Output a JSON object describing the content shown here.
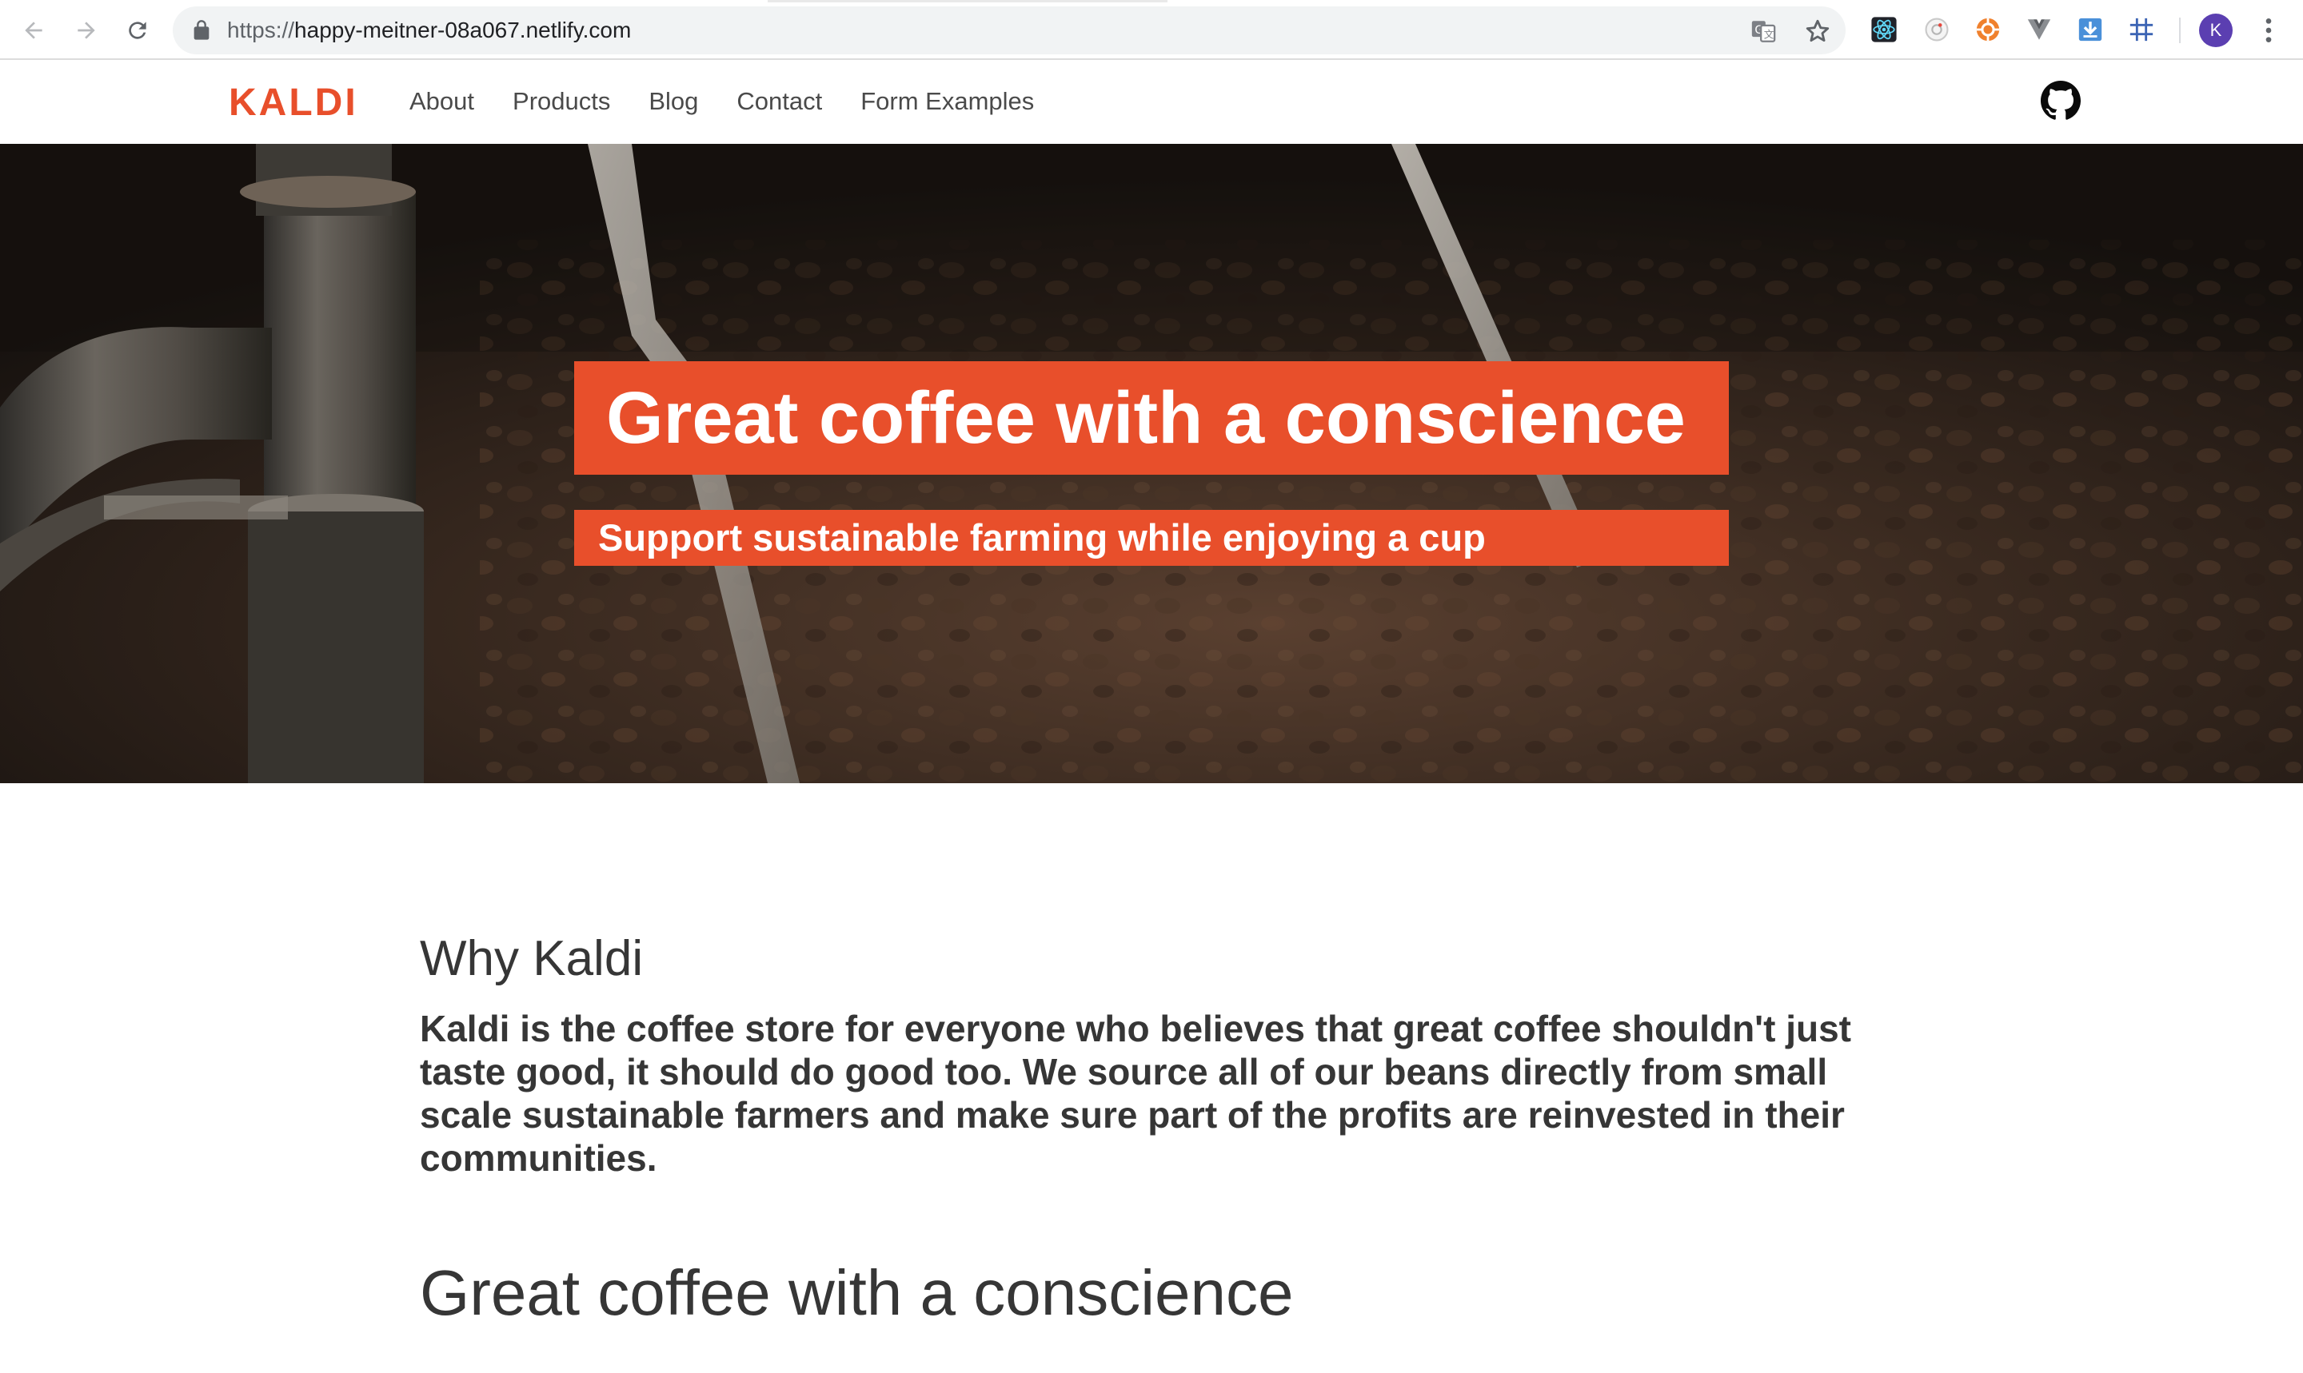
{
  "browser": {
    "url_scheme": "https://",
    "url_host": "happy-meitner-08a067.netlify.com",
    "profile_initial": "K",
    "icons": [
      "back-icon",
      "forward-icon",
      "reload-icon",
      "lock-icon",
      "translate-icon",
      "star-icon",
      "react-devtools-icon",
      "extension-icon",
      "extension-icon",
      "vue-devtools-icon",
      "download-icon",
      "grid-icon",
      "menu-icon"
    ]
  },
  "site": {
    "brand": "KALDI",
    "nav": [
      {
        "label": "About"
      },
      {
        "label": "Products"
      },
      {
        "label": "Blog"
      },
      {
        "label": "Contact"
      },
      {
        "label": "Form Examples"
      }
    ],
    "accent_color": "#e84f2b"
  },
  "hero": {
    "title": "Great coffee with a conscience",
    "subtitle": "Support sustainable farming while enjoying a cup"
  },
  "main": {
    "section_title": "Why Kaldi",
    "section_body": "Kaldi is the coffee store for everyone who believes that great coffee shouldn't just taste good, it should do good too. We source all of our beans directly from small scale sustainable farmers and make sure part of the profits are reinvested in their communities.",
    "second_title": "Great coffee with a conscience"
  }
}
